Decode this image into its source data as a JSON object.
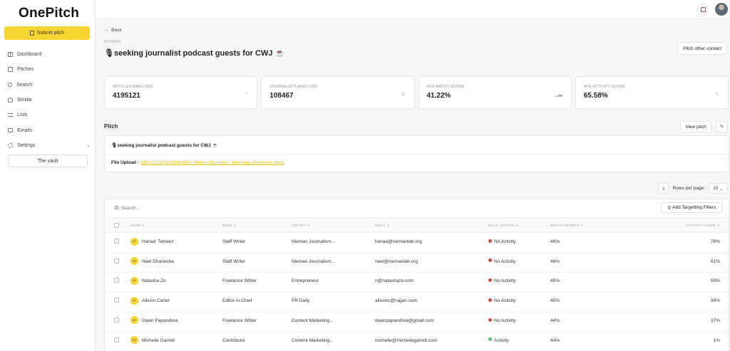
{
  "brand": {
    "logo": "OnePitch"
  },
  "sidebar": {
    "submit_label": "Submit pitch",
    "items": [
      {
        "label": "Dashboard",
        "icon": "dashboard-icon"
      },
      {
        "label": "Pitches",
        "icon": "pitches-icon"
      },
      {
        "label": "Search",
        "icon": "search-icon"
      },
      {
        "label": "Similar",
        "icon": "users-icon"
      },
      {
        "label": "Lists",
        "icon": "list-icon"
      },
      {
        "label": "Emails",
        "icon": "mail-icon"
      },
      {
        "label": "Settings",
        "icon": "gear-icon"
      }
    ],
    "vault_label": "The vault"
  },
  "header": {
    "back_label": "Back",
    "breadcrumb": "SCORES",
    "title": "🎙seeking journalist podcast guests for CWJ ☕",
    "pitch_other_label": "Pitch other contact"
  },
  "stats": [
    {
      "label": "ARTICLES ANALYZED",
      "value": "4195121",
      "icon": "search-icon"
    },
    {
      "label": "JOURNALISTS ANALYZED",
      "value": "108467",
      "icon": "user-icon"
    },
    {
      "label": "AVG MATCH SCORE",
      "value": "41.22%",
      "icon": "bar-chart-icon"
    },
    {
      "label": "AVG ACTIVITY SCORE",
      "value": "65.58%",
      "icon": "activity-icon"
    }
  ],
  "pitch": {
    "section_title": "Pitch",
    "view_label": "View pitch",
    "title": "🎙seeking journalist podcast guests for CWJ ☕",
    "file_upload_label": "File Upload :",
    "file_link": "pitch/1729PdS884Coffee With a Journalist - Interview Questions.docx"
  },
  "table": {
    "rows_per_page_label": "Rows per page:",
    "rows_per_page_value": "10",
    "search_placeholder": "Search...",
    "add_filters_label": "Add Targetting Filters",
    "columns": [
      "NAME ⇕",
      "ROLE ⇕",
      "OUTLET ⇕",
      "EMAIL ⇕",
      "EMAIL STATUS ⇕",
      "MATCH SCORES ⇕",
      "ACTIVITY SCORE ⇕"
    ],
    "status_colors": {
      "No Activity": "#e0443a",
      "Activity": "#4cc46a"
    },
    "rows": [
      {
        "initials": "HT",
        "name": "Hanaa' Tameez",
        "role": "Staff Writer",
        "outlet": "Nieman Journalism...",
        "email": "hanaa@niemanlab.org",
        "status": "No Activity",
        "match": "46%",
        "activity": "78%"
      },
      {
        "initials": "ND",
        "name": "Neel Dhanesha",
        "role": "Staff Writer",
        "outlet": "Nieman Journalism...",
        "email": "neel@niemanlab.org",
        "status": "No Activity",
        "match": "46%",
        "activity": "61%"
      },
      {
        "initials": "NZ",
        "name": "Natasha Zo",
        "role": "Freelance Writer",
        "outlet": "Entrepreneur",
        "email": "n@natashazo.com",
        "status": "No Activity",
        "match": "45%",
        "activity": "59%"
      },
      {
        "initials": "AC",
        "name": "Allison Carter",
        "role": "Editor-in-Chief",
        "outlet": "PR Daily",
        "email": "allisonc@ragan.com",
        "status": "No Activity",
        "match": "45%",
        "activity": "99%"
      },
      {
        "initials": "DP",
        "name": "Dawn Papandrea",
        "role": "Freelance Writer",
        "outlet": "Content Marketing...",
        "email": "dawnpapandrea@gmail.com",
        "status": "No Activity",
        "match": "44%",
        "activity": "37%"
      },
      {
        "initials": "MG",
        "name": "Michelle Garrett",
        "role": "Contributor",
        "outlet": "Content Marketing...",
        "email": "michelle@michellegarrett.com",
        "status": "Activity",
        "match": "44%",
        "activity": "1%"
      }
    ]
  }
}
